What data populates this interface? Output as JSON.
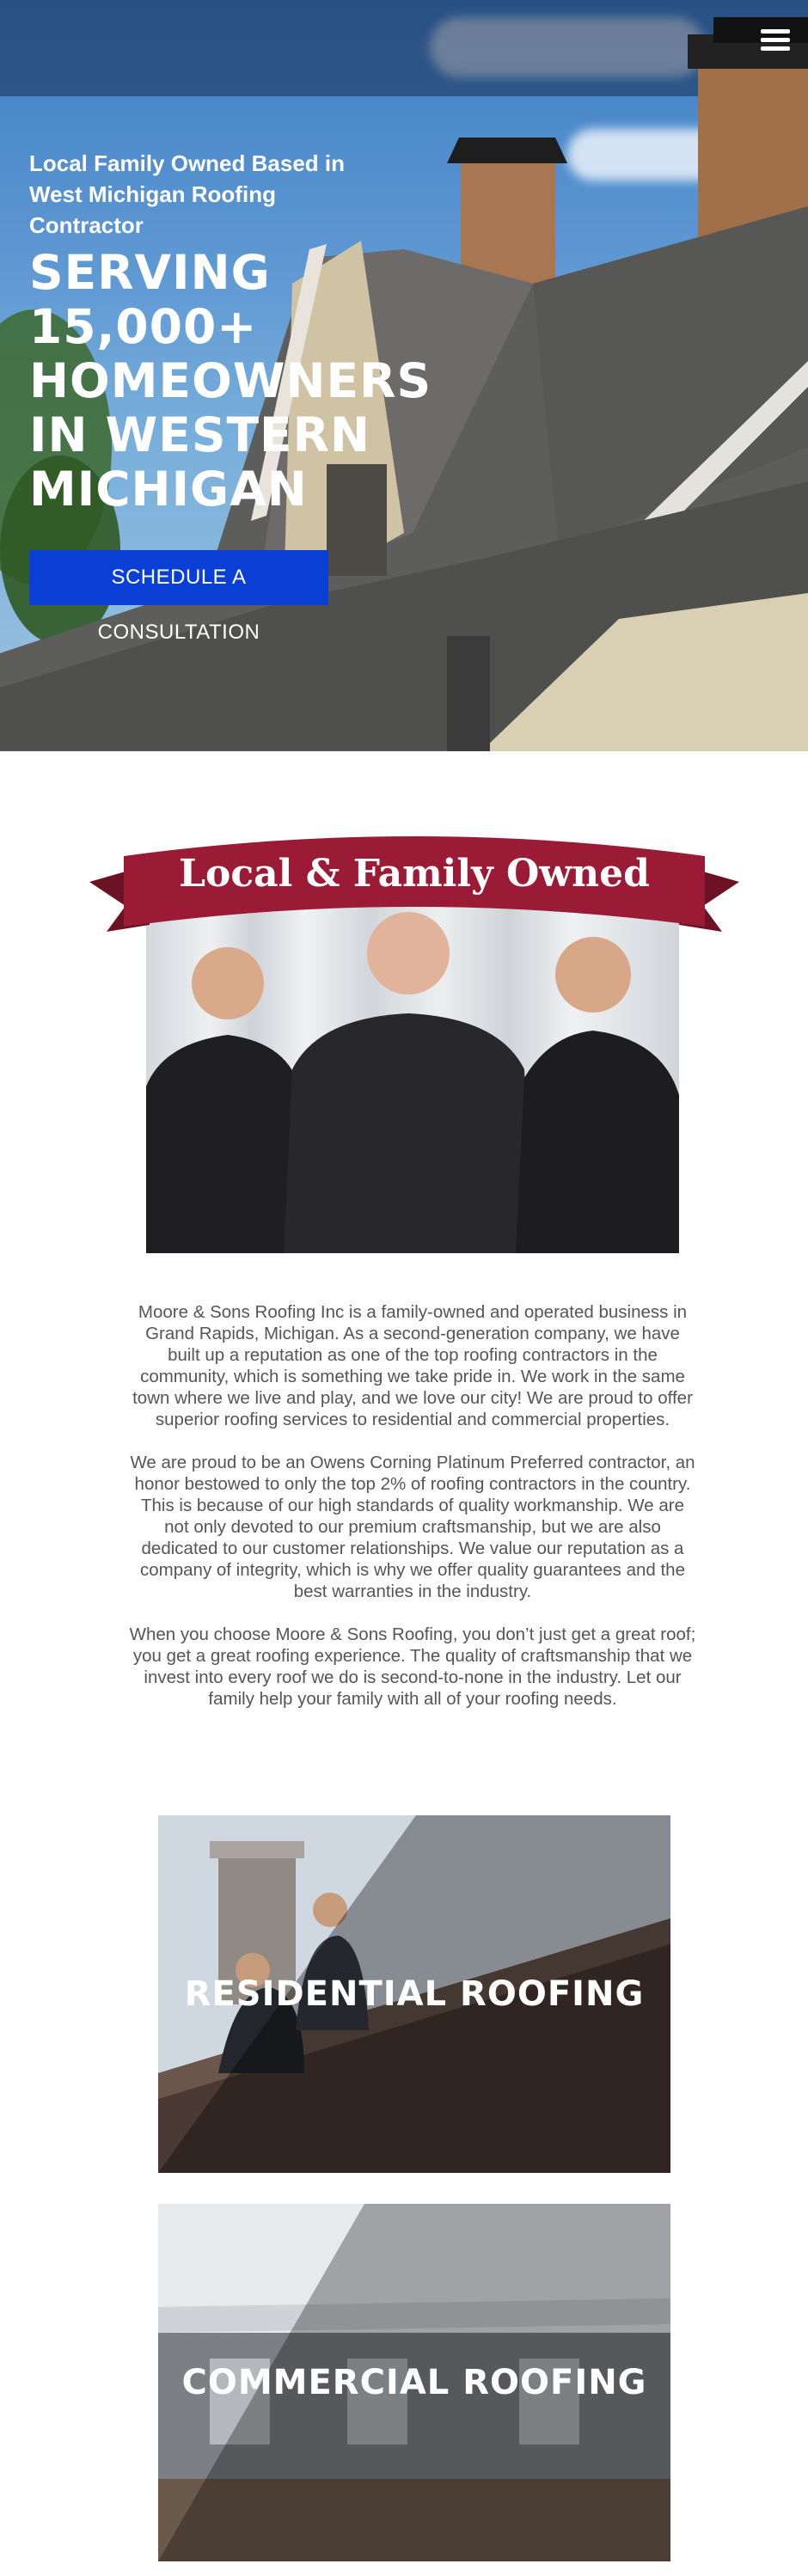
{
  "nav": {
    "menu_icon": "hamburger-menu-icon"
  },
  "hero": {
    "subtitle": "Local Family Owned Based in West Michigan Roofing Contractor",
    "title": "SERVING 15,000+ HOMEOWNERS IN WESTERN MICHIGAN",
    "cta_label": "SCHEDULE A CONSULTATION"
  },
  "family": {
    "banner_text": "Local & Family Owned",
    "colors": {
      "banner": "#9b1b36",
      "banner_dark": "#6d1125"
    }
  },
  "about": {
    "paragraphs": [
      "Moore & Sons Roofing Inc is a family-owned and operated business in Grand Rapids, Michigan. As a second-generation company, we have built up a reputation as one of the top roofing contractors in the community, which is something we take pride in. We work in the same town where we live and play, and we love our city! We are proud to offer superior roofing services to residential and commercial properties.",
      "We are proud to be an Owens Corning Platinum Preferred contractor, an honor bestowed to only the top 2% of roofing contractors in the country. This is because of our high standards of quality workmanship. We are not only devoted to our premium craftsmanship, but we are also dedicated to our customer relationships. We value our reputation as a company of integrity, which is why we offer quality guarantees and the best warranties in the industry.",
      "When you choose Moore & Sons Roofing, you don’t just get a great roof; you get a great roofing experience. The quality of craftsmanship that we invest into every roof we do is second-to-none in the industry. Let our family help your family with all of your roofing needs."
    ]
  },
  "services": {
    "residential": "RESIDENTIAL ROOFING",
    "commercial": "COMMERCIAL ROOFING"
  },
  "colors": {
    "cta": "#0a3fd6",
    "text": "#555555"
  }
}
